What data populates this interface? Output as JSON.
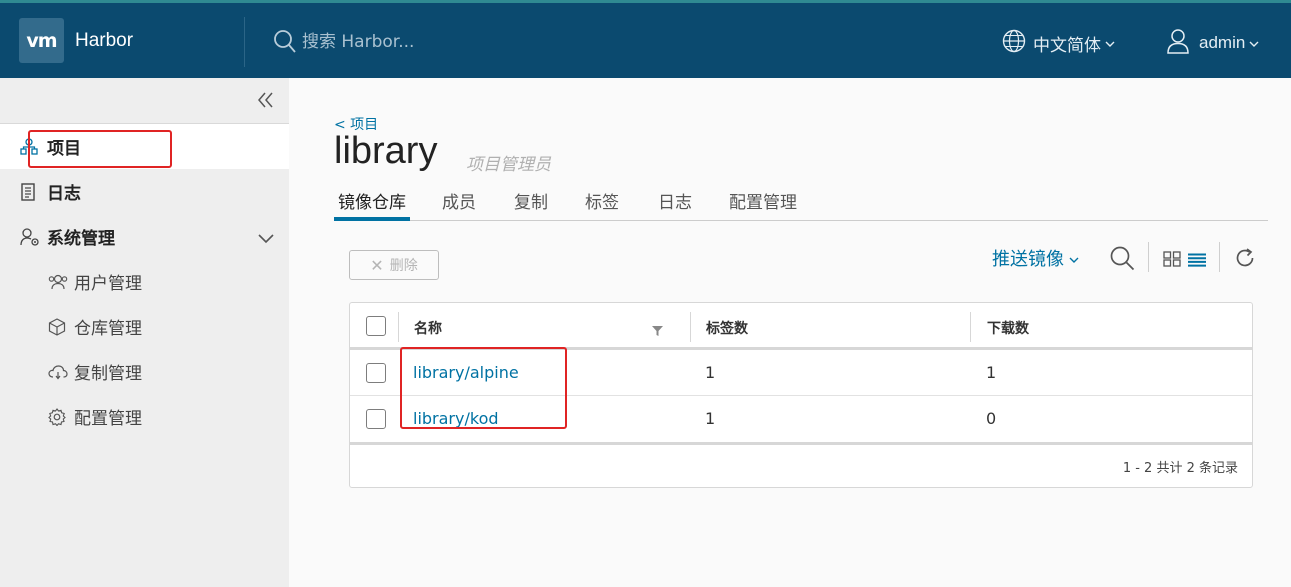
{
  "header": {
    "logo_text": "vm",
    "brand": "Harbor",
    "search_placeholder": "搜索 Harbor...",
    "language": "中文简体",
    "user": "admin",
    "colors": {
      "bg": "#0b4a6f",
      "top_stripe": "#2f8a92"
    }
  },
  "sidebar": {
    "items": [
      {
        "label": "项目",
        "icon": "project-icon",
        "active": true
      },
      {
        "label": "日志",
        "icon": "log-icon"
      },
      {
        "label": "系统管理",
        "icon": "admin-icon",
        "expanded": true
      }
    ],
    "sub_items": [
      {
        "label": "用户管理",
        "icon": "users-icon"
      },
      {
        "label": "仓库管理",
        "icon": "cube-icon"
      },
      {
        "label": "复制管理",
        "icon": "cloud-icon"
      },
      {
        "label": "配置管理",
        "icon": "gear-icon"
      }
    ]
  },
  "main": {
    "back_link": "< 项目",
    "title": "library",
    "role": "项目管理员",
    "tabs": [
      "镜像仓库",
      "成员",
      "复制",
      "标签",
      "日志",
      "配置管理"
    ],
    "active_tab": "镜像仓库",
    "delete_button": "删除",
    "push_button": "推送镜像",
    "table": {
      "headers": [
        "名称",
        "标签数",
        "下载数"
      ],
      "rows": [
        {
          "name": "library/alpine",
          "tags": "1",
          "pulls": "1"
        },
        {
          "name": "library/kod",
          "tags": "1",
          "pulls": "0"
        }
      ],
      "footer": "1 - 2 共计 2 条记录"
    },
    "accent_color": "#0072a3",
    "annotation_color": "#e02424"
  }
}
